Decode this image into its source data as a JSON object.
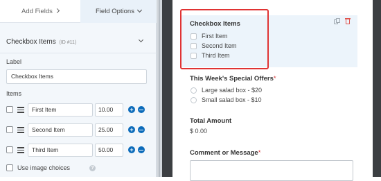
{
  "tabs": {
    "add_fields": "Add Fields",
    "field_options": "Field Options"
  },
  "field": {
    "name": "Checkbox Items",
    "id_text": "(ID #11)",
    "label_caption": "Label",
    "label_value": "Checkbox Items",
    "items_caption": "Items",
    "items": [
      {
        "text": "First Item",
        "value": "10.00"
      },
      {
        "text": "Second Item",
        "value": "25.00"
      },
      {
        "text": "Third Item",
        "value": "50.00"
      }
    ],
    "image_choices_label": "Use image choices"
  },
  "preview": {
    "checkbox_title": "Checkbox Items",
    "checkbox_options": [
      "First Item",
      "Second Item",
      "Third Item"
    ],
    "offers_title": "This Week's Special Offers",
    "offers_required": "*",
    "offers_options": [
      "Large salad box - $20",
      "Small salad box - $10"
    ],
    "total_title": "Total Amount",
    "total_value": "$ 0.00",
    "comment_title": "Comment or Message",
    "comment_required": "*"
  },
  "colors": {
    "accent_blue": "#0b6bba",
    "highlight_red": "#e03333",
    "required_red": "#d63638",
    "panel_bg": "#f3f7fb",
    "dark_bg": "#3c3f42",
    "selected_field_bg": "#ecf4fb"
  },
  "icons": [
    "chevron-right-icon",
    "chevron-down-icon",
    "drag-handle-icon",
    "add-item-icon",
    "remove-item-icon",
    "help-icon",
    "duplicate-icon",
    "trash-icon"
  ]
}
